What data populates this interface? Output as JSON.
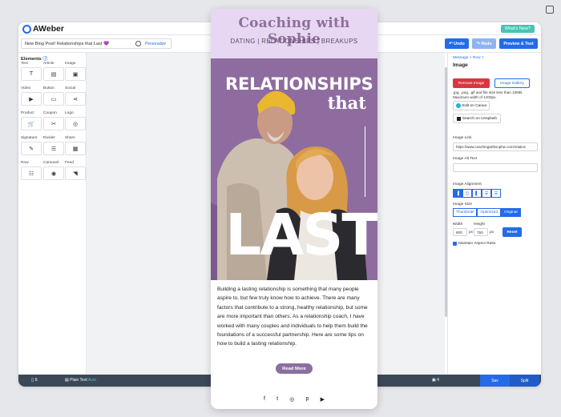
{
  "app": {
    "logo": "AWeber",
    "whats_new": "What's New?"
  },
  "toolbar": {
    "subject": "New Blog Post! Relationships that Last 💜",
    "personalize": "Personalize",
    "undo": "↶ Undo",
    "redo": "↷ Redo",
    "preview": "Preview & Test"
  },
  "elements": {
    "title": "Elements",
    "items": [
      {
        "label": "Text",
        "glyph": "T"
      },
      {
        "label": "Article",
        "glyph": "▤"
      },
      {
        "label": "Image",
        "glyph": "▣"
      },
      {
        "label": "Video",
        "glyph": "▶"
      },
      {
        "label": "Button",
        "glyph": "▭"
      },
      {
        "label": "Social",
        "glyph": "⋖"
      },
      {
        "label": "Product",
        "glyph": "🛒"
      },
      {
        "label": "Coupon",
        "glyph": "✂"
      },
      {
        "label": "Logo",
        "glyph": "◎"
      },
      {
        "label": "Signature",
        "glyph": "✎"
      },
      {
        "label": "Divider",
        "glyph": "☰"
      },
      {
        "label": "Share",
        "glyph": "▦"
      },
      {
        "label": "Row",
        "glyph": "☷"
      },
      {
        "label": "Carousel",
        "glyph": "◉"
      },
      {
        "label": "Feed",
        "glyph": "◥"
      }
    ]
  },
  "props": {
    "breadcrumb": "Message  >  Row  >",
    "title": "Image",
    "remove_image": "Remove Image",
    "image_gallery": "Image Gallery",
    "hint": ".jpg, .png, .gif and file size less than 10MB. Maximum width of 1200px.",
    "edit_canva": "Edit on Canva",
    "search_unsplash": "Search on Unsplash",
    "image_link_label": "Image Link",
    "image_link_value": "https://www.coachingwithsophie.com/relation",
    "alt_text_label": "Image Alt Text",
    "alt_text_value": "",
    "alignment_label": "Image Alignment",
    "size_label": "Image Size",
    "size_options": [
      "Thumbnail",
      "Optimized",
      "Original"
    ],
    "width_label": "Width",
    "width_value": "600",
    "height_label": "Height",
    "height_value": "750",
    "px": "px",
    "reset": "Reset",
    "maintain_ratio": "Maintain Aspect Ratio"
  },
  "bottom": {
    "count": "6",
    "plain_text": "Plain Text",
    "auto": "Auto",
    "right_count": "4",
    "save": "Sav",
    "split": "Split"
  },
  "email": {
    "brand": "Coaching with Sophie",
    "tagline": "DATING | RELATIONSHIPS | BREAKUPS",
    "hero_line1": "RELATIONSHIPS",
    "hero_line2": "that",
    "hero_line3": "LAST",
    "body": "Building a lasting relationship is something that many people aspire to, but few truly know how to achieve. There are many factors that contribute to a strong, healthy relationship, but some are more important than others. As a relationship coach, I have worked with many couples and individuals to help them build the foundations of a successful partnership. Here are some tips on how to build a lasting relationship.",
    "read_more": "Read More",
    "socials": [
      "f",
      "t",
      "◎",
      "p",
      "▶"
    ]
  },
  "colors": {
    "accent": "#246be8",
    "brand_purple": "#8c6f9c",
    "header_bg": "#e8d7f2",
    "danger": "#d9363e"
  }
}
